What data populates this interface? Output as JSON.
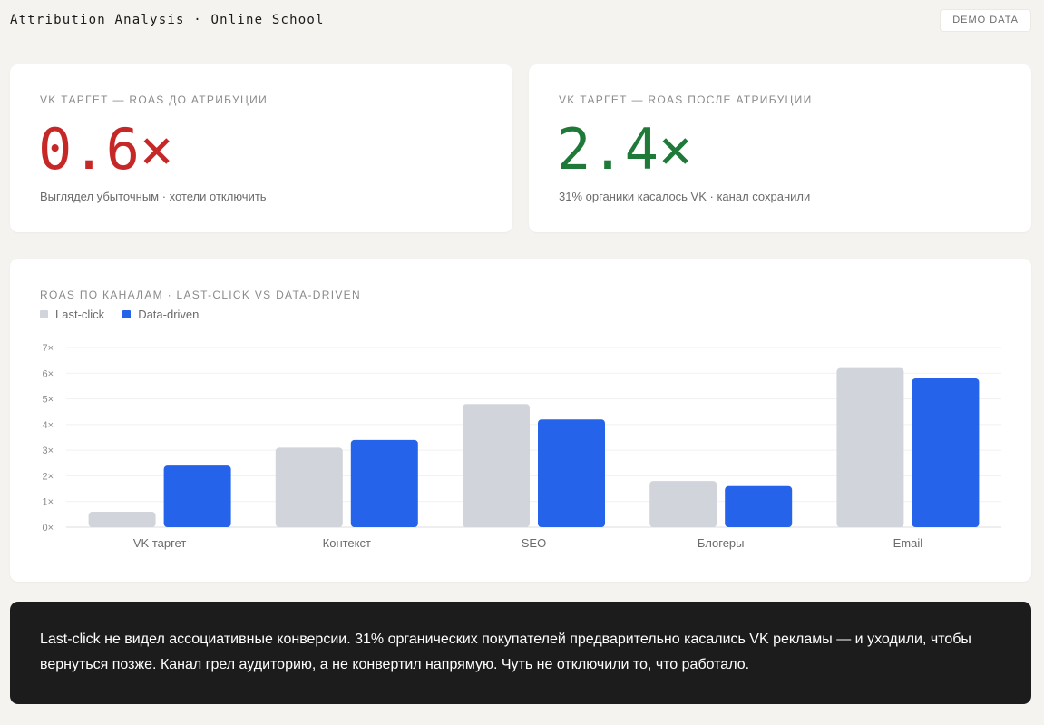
{
  "header": {
    "title": "Attribution Analysis · Online School",
    "badge": "DEMO DATA"
  },
  "kpis": {
    "before": {
      "label": "VK таргет — ROAS до атрибуции",
      "value": "0.6×",
      "note": "Выглядел убыточным · хотели отключить",
      "color": "#c62828"
    },
    "after": {
      "label": "VK таргет — ROAS после атрибуции",
      "value": "2.4×",
      "note": "31% органики касалось VK · канал сохранили",
      "color": "#1f7a3a"
    }
  },
  "chart": {
    "title": "ROAS по каналам · Last-click vs Data-driven"
  },
  "chart_data": {
    "type": "bar",
    "categories": [
      "VK таргет",
      "Контекст",
      "SEO",
      "Блогеры",
      "Email"
    ],
    "series": [
      {
        "name": "Last-click",
        "values": [
          0.6,
          3.1,
          4.8,
          1.8,
          6.2
        ],
        "color": "#d1d5db"
      },
      {
        "name": "Data-driven",
        "values": [
          2.4,
          3.4,
          4.2,
          1.6,
          5.8
        ],
        "color": "#2563eb"
      }
    ],
    "ylim": [
      0,
      7
    ],
    "yticks": [
      "0×",
      "1×",
      "2×",
      "3×",
      "4×",
      "5×",
      "6×",
      "7×"
    ],
    "legend": "top-left",
    "grid": true
  },
  "insight": {
    "text": "Last-click не видел ассоциативные конверсии. 31% органических покупателей предварительно касались VK рекламы — и уходили, чтобы вернуться позже. Канал грел аудиторию, а не конвертил напрямую. Чуть не отключили то, что работало."
  }
}
